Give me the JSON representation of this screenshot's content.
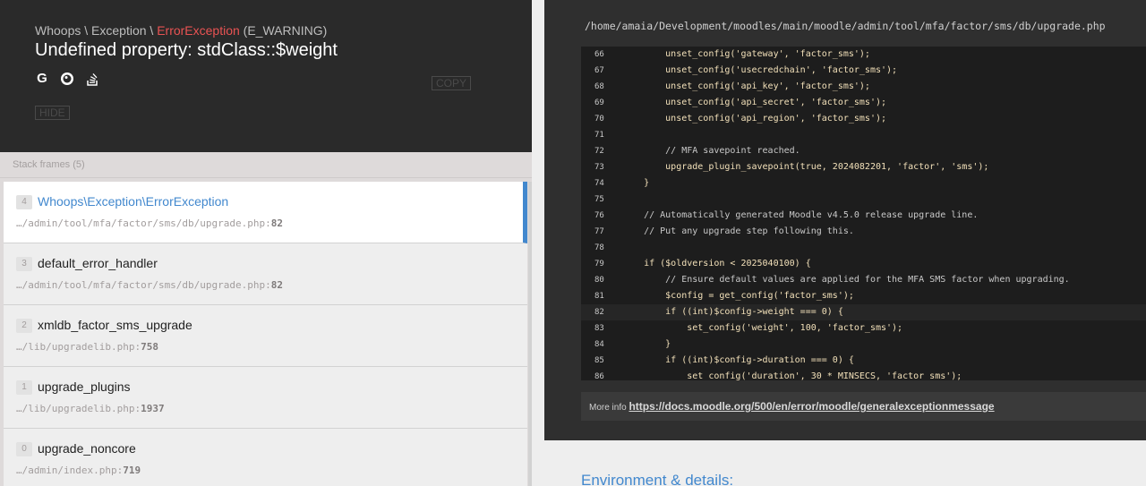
{
  "header": {
    "exc_prefix": "Whoops \\ Exception \\ ",
    "exc_class": "ErrorException",
    "exc_code": " (E_WARNING)",
    "message": "Undefined property: stdClass::$weight",
    "copy_label": "COPY",
    "hide_label": "HIDE",
    "search_icons": [
      "google-icon",
      "duckduckgo-icon",
      "stackoverflow-icon"
    ]
  },
  "frames_title": "Stack frames (5)",
  "frames": [
    {
      "index": "4",
      "name": "Whoops\\Exception\\ErrorException",
      "file": "…/admin/tool/mfa/factor/sms/db/upgrade.php",
      "line": "82"
    },
    {
      "index": "3",
      "name": "default_error_handler",
      "file": "…/admin/tool/mfa/factor/sms/db/upgrade.php",
      "line": "82"
    },
    {
      "index": "2",
      "name": "xmldb_factor_sms_upgrade",
      "file": "…/lib/upgradelib.php",
      "line": "758"
    },
    {
      "index": "1",
      "name": "upgrade_plugins",
      "file": "…/lib/upgradelib.php",
      "line": "1937"
    },
    {
      "index": "0",
      "name": "upgrade_noncore",
      "file": "…/admin/index.php",
      "line": "719"
    }
  ],
  "code": {
    "file_path": "/home/amaia/Development/moodles/main/moodle/admin/tool/mfa/factor/sms/db/upgrade.php",
    "lines": [
      {
        "n": "66",
        "t": "        unset_config('gateway', 'factor_sms');"
      },
      {
        "n": "67",
        "t": "        unset_config('usecredchain', 'factor_sms');"
      },
      {
        "n": "68",
        "t": "        unset_config('api_key', 'factor_sms');"
      },
      {
        "n": "69",
        "t": "        unset_config('api_secret', 'factor_sms');"
      },
      {
        "n": "70",
        "t": "        unset_config('api_region', 'factor_sms');"
      },
      {
        "n": "71",
        "t": ""
      },
      {
        "n": "72",
        "t": "        // MFA savepoint reached."
      },
      {
        "n": "73",
        "t": "        upgrade_plugin_savepoint(true, 2024082201, 'factor', 'sms');"
      },
      {
        "n": "74",
        "t": "    }"
      },
      {
        "n": "75",
        "t": ""
      },
      {
        "n": "76",
        "t": "    // Automatically generated Moodle v4.5.0 release upgrade line."
      },
      {
        "n": "77",
        "t": "    // Put any upgrade step following this."
      },
      {
        "n": "78",
        "t": ""
      },
      {
        "n": "79",
        "t": "    if ($oldversion < 2025040100) {"
      },
      {
        "n": "80",
        "t": "        // Ensure default values are applied for the MFA SMS factor when upgrading."
      },
      {
        "n": "81",
        "t": "        $config = get_config('factor_sms');"
      },
      {
        "n": "82",
        "t": "        if ((int)$config->weight === 0) {"
      },
      {
        "n": "83",
        "t": "            set_config('weight', 100, 'factor_sms');"
      },
      {
        "n": "84",
        "t": "        }"
      },
      {
        "n": "85",
        "t": "        if ((int)$config->duration === 0) {"
      },
      {
        "n": "86",
        "t": "            set_config('duration', 30 * MINSECS, 'factor_sms');"
      }
    ],
    "highlight_line": "82"
  },
  "more_info": {
    "label": "More info ",
    "url": "https://docs.moodle.org/500/en/error/moodle/generalexceptionmessage"
  },
  "env_title": "Environment & details:"
}
